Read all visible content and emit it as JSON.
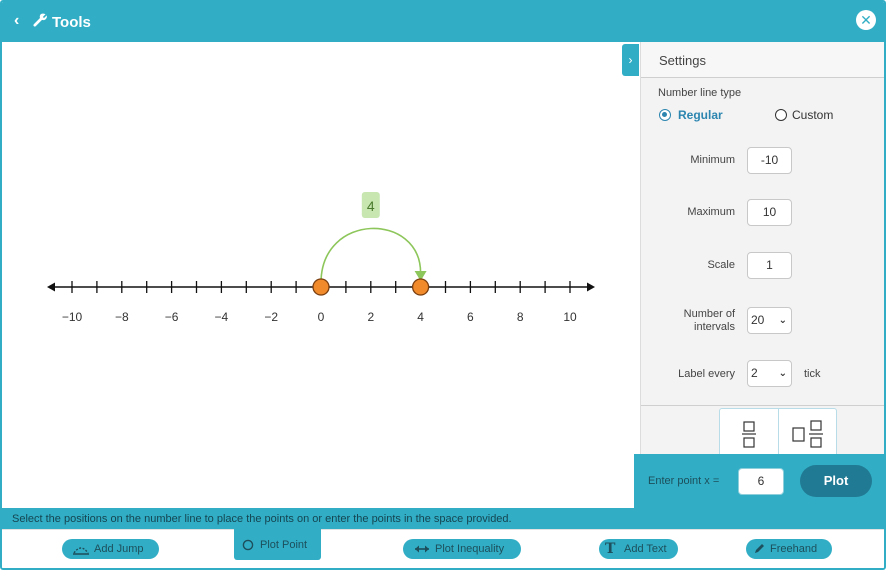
{
  "header": {
    "title": "Tools",
    "back_icon": "chevron-left-icon",
    "tool_icon": "wrench-icon",
    "close_icon": "close-icon"
  },
  "number_line": {
    "min": -10,
    "max": 10,
    "scale": 1,
    "intervals": 20,
    "label_every": 2,
    "tick_labels": [
      "−10",
      "−8",
      "−6",
      "−4",
      "−2",
      "0",
      "2",
      "4",
      "6",
      "8",
      "10"
    ],
    "points": [
      0,
      4
    ],
    "jump": {
      "from": 0,
      "to": 4,
      "label": "4"
    },
    "colors": {
      "point": "#f08a2b",
      "jump": "#8dc65a",
      "jump_label_bg": "#c8e6b0",
      "line": "#111111"
    }
  },
  "settings": {
    "title": "Settings",
    "type_label": "Number line type",
    "type_options": [
      "Regular",
      "Custom"
    ],
    "type_selected": "Regular",
    "minimum_label": "Minimum",
    "minimum_value": "-10",
    "maximum_label": "Maximum",
    "maximum_value": "10",
    "scale_label": "Scale",
    "scale_value": "1",
    "intervals_label_1": "Number of",
    "intervals_label_2": "intervals",
    "intervals_value": "20",
    "label_every_label": "Label every",
    "label_every_value": "2",
    "tick_suffix": "tick"
  },
  "plot": {
    "label": "Enter point x =",
    "value": "6",
    "button": "Plot"
  },
  "instruction": "Select the positions on the number line to place the points on or enter the points in the space provided.",
  "toolbar": {
    "add_jump": "Add Jump",
    "plot_point": "Plot Point",
    "plot_inequality": "Plot Inequality",
    "add_text": "Add Text",
    "freehand": "Freehand"
  },
  "colors": {
    "accent": "#31aec5",
    "plot_button": "#217a93",
    "radio_selected": "#2c86b0"
  }
}
